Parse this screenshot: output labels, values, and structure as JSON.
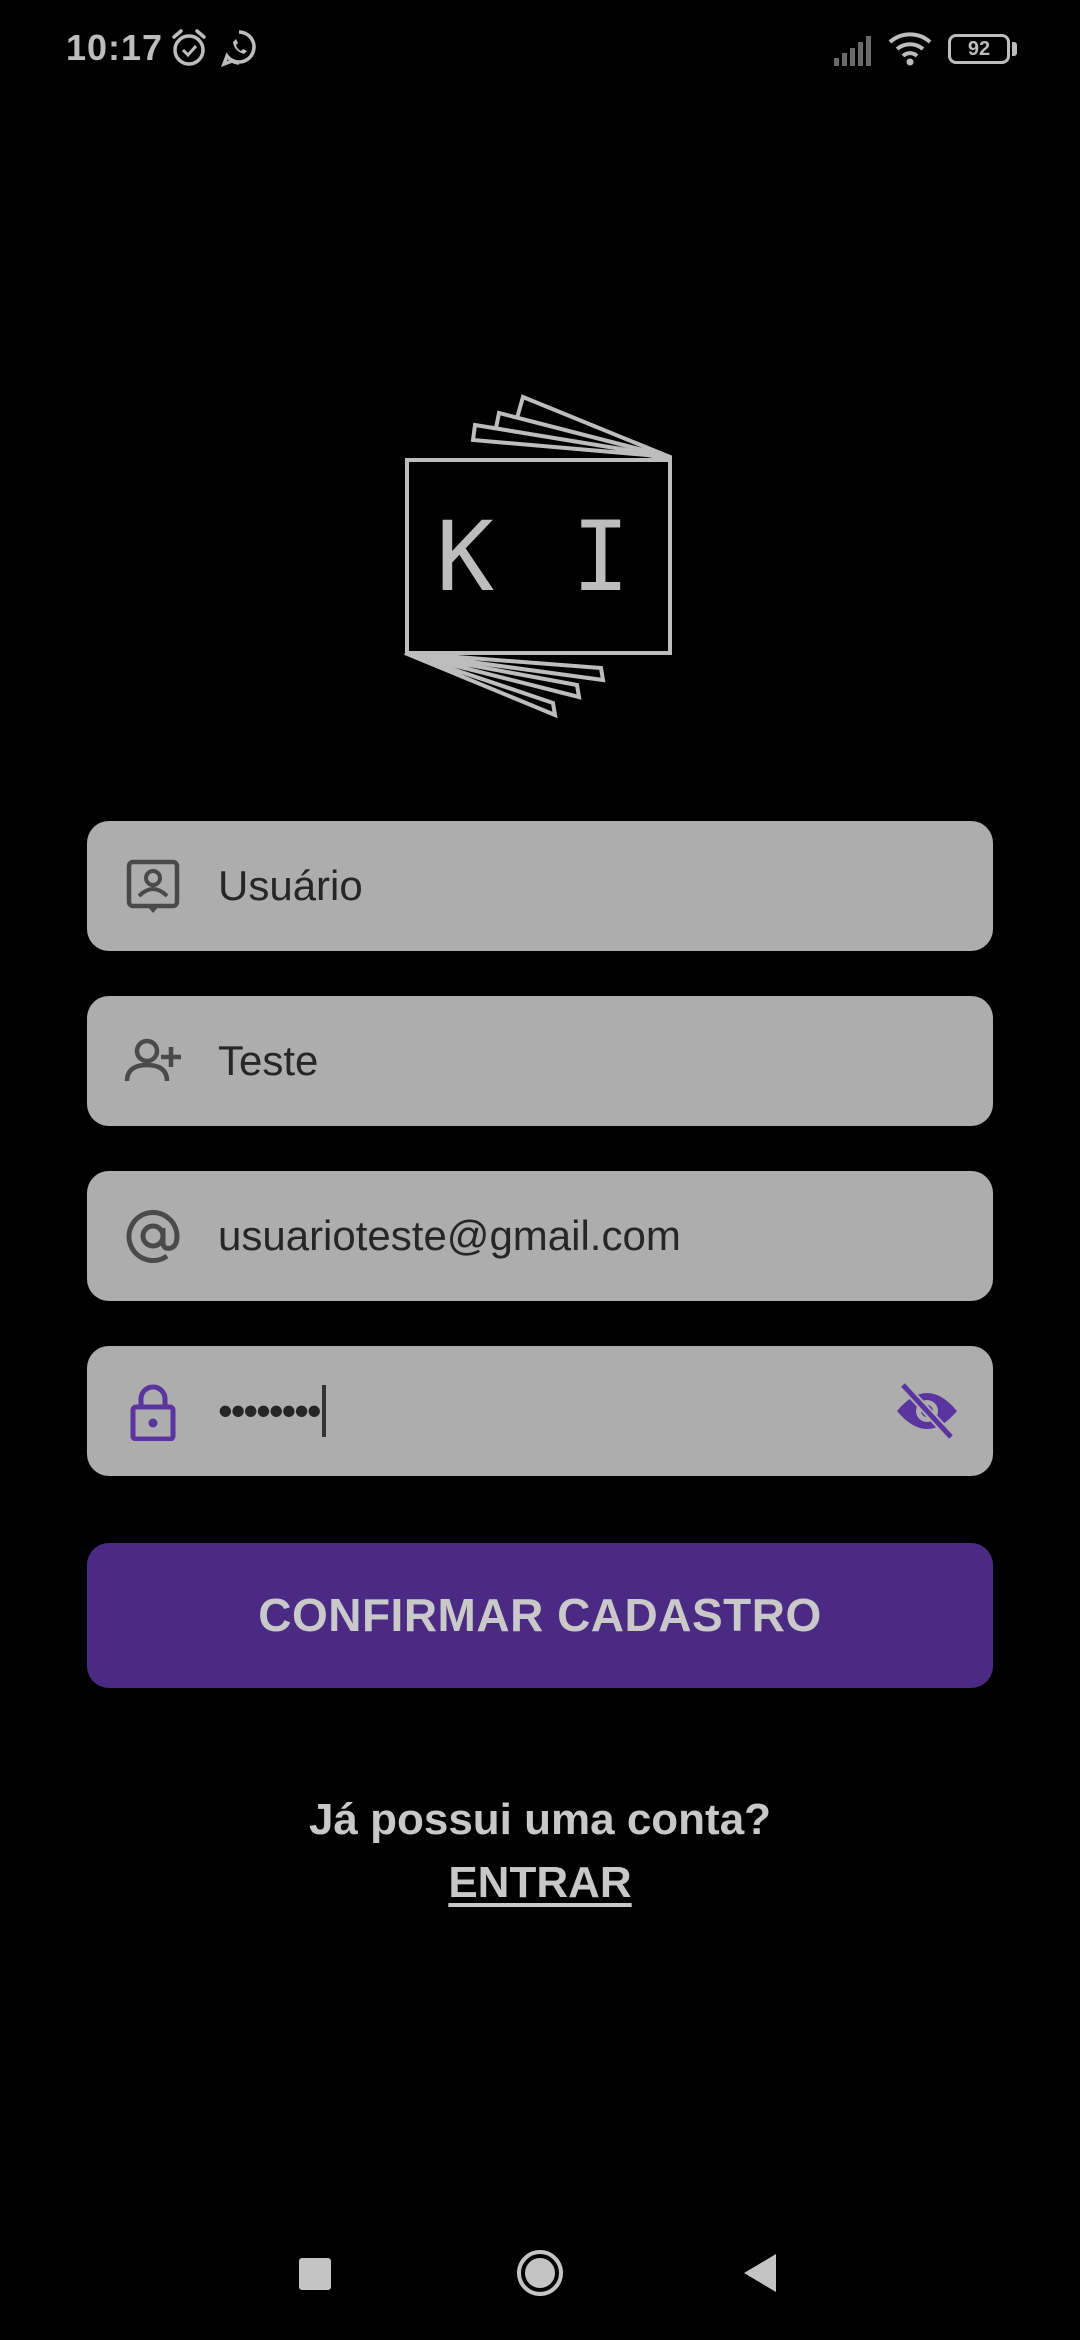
{
  "status_bar": {
    "time": "10:17",
    "battery": "92",
    "icons": [
      "alarm-icon",
      "whatsapp-icon",
      "signal-icon",
      "wifi-icon",
      "battery-icon"
    ]
  },
  "logo": {
    "text": "K I"
  },
  "form": {
    "username": {
      "value": "Usuário",
      "icon": "contact-card-icon"
    },
    "name": {
      "value": "Teste",
      "icon": "person-add-icon"
    },
    "email": {
      "value": "usuarioteste@gmail.com",
      "icon": "at-sign-icon"
    },
    "password": {
      "value": "••••••••",
      "icon": "lock-icon",
      "toggle_icon": "eye-off-icon"
    }
  },
  "confirm_button": {
    "label": "CONFIRMAR CADASTRO"
  },
  "login_prompt": {
    "question": "Já possui uma conta?",
    "link_label": "ENTRAR"
  },
  "nav_bar": {
    "icons": [
      "recents-icon",
      "home-icon",
      "back-icon"
    ]
  },
  "colors": {
    "background": "#000000",
    "field": "#adadad",
    "accent": "#4b2a84",
    "accent_icon": "#5a35a0",
    "text_light": "#c8c8c8"
  }
}
